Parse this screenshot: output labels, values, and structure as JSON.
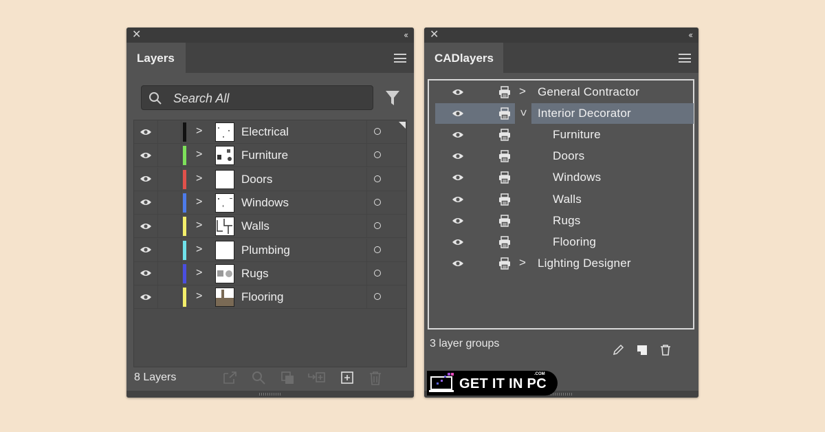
{
  "colors": {
    "background": "#f5e3cc",
    "panel": "#535353",
    "titlebar": "#3b3b3b",
    "selection": "#68717d",
    "text": "#efefef"
  },
  "layers_panel": {
    "tab_label": "Layers",
    "search_placeholder": "Search All",
    "icons": {
      "close": "close-icon",
      "collapse": "double-chevron-left-icon",
      "menu": "hamburger-menu-icon",
      "search": "search-icon",
      "filter": "funnel-filter-icon"
    },
    "layers": [
      {
        "name": "Electrical",
        "color": "#111111",
        "visible": true
      },
      {
        "name": "Furniture",
        "color": "#7de05a",
        "visible": true
      },
      {
        "name": "Doors",
        "color": "#e0514b",
        "visible": true
      },
      {
        "name": "Windows",
        "color": "#4d7bea",
        "visible": true
      },
      {
        "name": "Walls",
        "color": "#f3ee6a",
        "visible": true
      },
      {
        "name": "Plumbing",
        "color": "#6fe1ea",
        "visible": true
      },
      {
        "name": "Rugs",
        "color": "#4a4ee0",
        "visible": true
      },
      {
        "name": "Flooring",
        "color": "#f3ee6a",
        "visible": true
      }
    ],
    "footer_count": "8 Layers",
    "footer_icons": [
      "export-icon",
      "locate-object-icon",
      "make-clipping-mask-icon",
      "create-sublayer-icon",
      "new-layer-icon",
      "delete-icon"
    ]
  },
  "cad_panel": {
    "tab_label": "CADlayers",
    "rows": [
      {
        "name": "General Contractor",
        "type": "group",
        "expanded": false,
        "selected": false
      },
      {
        "name": "Interior Decorator",
        "type": "group",
        "expanded": true,
        "selected": true
      },
      {
        "name": "Furniture",
        "type": "child"
      },
      {
        "name": "Doors",
        "type": "child"
      },
      {
        "name": "Windows",
        "type": "child"
      },
      {
        "name": "Walls",
        "type": "child"
      },
      {
        "name": "Rugs",
        "type": "child"
      },
      {
        "name": "Flooring",
        "type": "child"
      },
      {
        "name": "Lighting Designer",
        "type": "group",
        "expanded": false,
        "selected": false
      }
    ],
    "footer_text": "3 layer groups",
    "tool_icons": [
      "pencil-edit-icon",
      "new-page-icon",
      "trash-icon"
    ]
  },
  "watermark": {
    "text": "GET IT IN PC",
    "suffix": ".COM"
  }
}
